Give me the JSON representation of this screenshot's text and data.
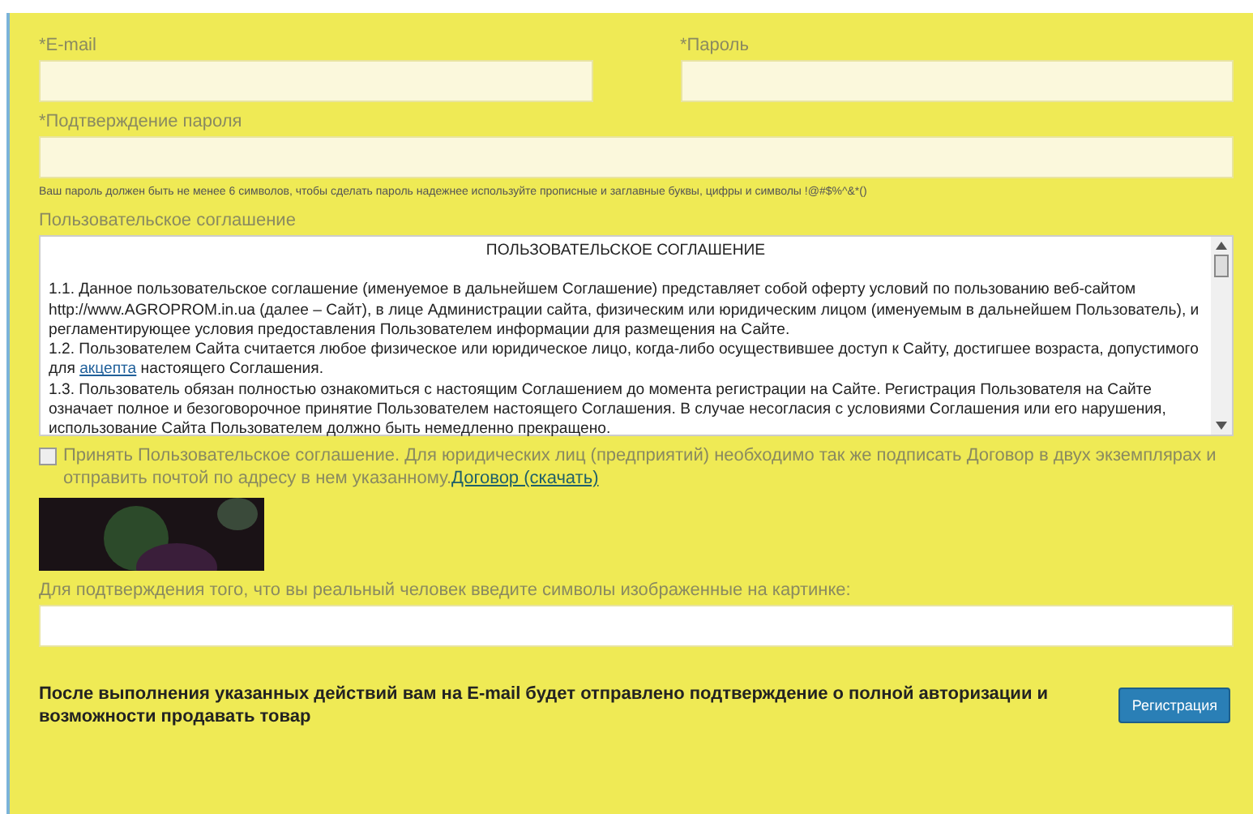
{
  "fields_row": [
    {
      "label": "*E-mail"
    },
    {
      "label": "*Пароль"
    }
  ],
  "confirm_password": {
    "label": "*Подтверждение пароля"
  },
  "password_hint": "Ваш пароль должен быть не менее 6 символов, чтобы сделать пароль надежнее используйте прописные и заглавные буквы, цифры и символы !@#$%^&*()",
  "agreement": {
    "label": "Пользовательское соглашение",
    "title": "ПОЛЬЗОВАТЕЛЬСКОЕ СОГЛАШЕНИЕ",
    "paragraphs": [
      {
        "before": "1.1. Данное пользовательское соглашение (именуемое в дальнейшем Соглашение) представляет собой оферту условий по пользованию веб-сайтом http://www.AGROPROM.in.ua (далее – Сайт), в лице Администрации сайта,  физическим или юридическим лицом (именуемым в дальнейшем Пользователь), и регламентирующее условия предоставления Пользователем информации для размещения на Сайте."
      },
      {
        "before": "1.2. Пользователем Сайта считается любое физическое или юридическое лицо, когда-либо осуществившее доступ к Сайту, достигшее возраста, допустимого для ",
        "link": "акцепта",
        "after": " настоящего Соглашения."
      },
      {
        "before": "1.3. Пользователь обязан полностью ознакомиться с настоящим Соглашением до момента регистрации на Сайте. Регистрация Пользователя на Сайте означает полное и безоговорочное принятие Пользователем настоящего Соглашения. В случае несогласия с условиями Соглашения или его нарушения, использование Сайта Пользователем должно быть немедленно прекращено."
      }
    ]
  },
  "accept": {
    "checked": false,
    "text": "Принять Пользовательское соглашение. Для юридических лиц (предприятий) необходимо так же подписать Договор в двух экземплярах и отправить почтой по адресу в нем указанному.",
    "link": "Договор (скачать)"
  },
  "captcha": {
    "label": "Для подтверждения того, что вы реальный человек введите символы изображенные на картинке:"
  },
  "notice": "После выполнения указанных действий вам на E-mail будет отправлено подтверждение о полной авторизации и возможности продавать товар",
  "submit": "Регистрация"
}
